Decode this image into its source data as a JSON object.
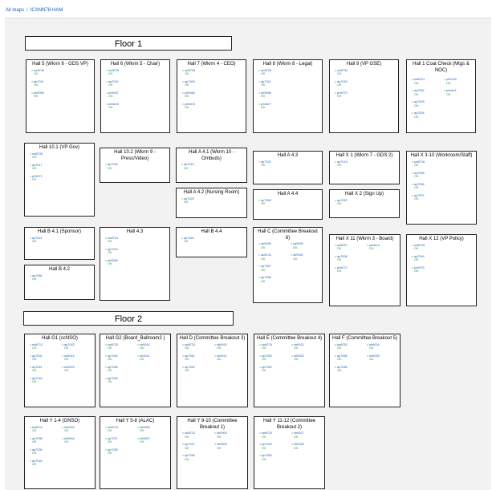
{
  "breadcrumb": {
    "all_maps": "All maps",
    "separator": "/",
    "current": "ICANN78-HAM"
  },
  "floors": {
    "floor1": "Floor 1",
    "floor2": "Floor 2"
  },
  "status_color": "#2e9a2e",
  "link_color": "#1a5fb4",
  "halls": [
    {
      "id": "hall-5",
      "title": "Hall 5 (Wkrm 6 - GDS VP)",
      "devices": [
        {
          "name": "sw8740",
          "status": "OK"
        },
        {
          "name": "ap7011",
          "status": "OK"
        },
        {
          "name": "ph9069",
          "status": "OK"
        }
      ]
    },
    {
      "id": "hall-6",
      "title": "Hall 6 (Wkrm 5 - Chair)",
      "devices": [
        {
          "name": "sw8729",
          "status": "OK"
        },
        {
          "name": "ap7010",
          "status": "OK"
        },
        {
          "name": "ph9067",
          "status": "OK"
        },
        {
          "name": "printer6",
          "status": "OK"
        }
      ]
    },
    {
      "id": "hall-7",
      "title": "Hall 7 (Wkrm 4 - CEO)",
      "devices": [
        {
          "name": "sw8728",
          "status": "OK"
        },
        {
          "name": "ap7009",
          "status": "OK"
        },
        {
          "name": "ph9066",
          "status": "OK"
        },
        {
          "name": "printer5",
          "status": "OK"
        }
      ]
    },
    {
      "id": "hall-8",
      "title": "Hall 8 (Wkrm 8 - Legal)",
      "devices": [
        {
          "name": "sw8725",
          "status": "OK"
        },
        {
          "name": "ap7012",
          "status": "OK"
        },
        {
          "name": "ph9068",
          "status": "OK"
        },
        {
          "name": "printer7",
          "status": "OK"
        }
      ]
    },
    {
      "id": "hall-9",
      "title": "Hall 9 (VP GSE)",
      "devices": [
        {
          "name": "sw8732",
          "status": "OK"
        },
        {
          "name": "ap7015",
          "status": "OK"
        },
        {
          "name": "ph9073",
          "status": "OK"
        }
      ]
    },
    {
      "id": "hall-1",
      "title": "Hall 1 Coat Check (Mtgs & NOC)",
      "devices": [
        {
          "name": "sw8701",
          "status": "OK"
        },
        {
          "name": "ph0218",
          "status": "OK"
        },
        {
          "name": "ap7002",
          "status": "OK"
        },
        {
          "name": "printer1",
          "status": "OK"
        },
        {
          "name": "ap7003",
          "status": "OK"
        },
        {
          "name": "ap7004",
          "status": "OK"
        }
      ]
    },
    {
      "id": "hall-10-1",
      "title": "Hall 10.1 (VP Gov)",
      "devices": [
        {
          "name": "sw8735",
          "status": "OK"
        },
        {
          "name": "ap7017",
          "status": "OK"
        },
        {
          "name": "ph9071",
          "status": "OK"
        }
      ]
    },
    {
      "id": "hall-10-2",
      "title": "Hall 10.2 (Wkrm 9 - Press/Video)",
      "devices": [
        {
          "name": "ap7018",
          "status": "OK"
        }
      ]
    },
    {
      "id": "hall-a-4-1",
      "title": "Hall A 4.1 (Wkrm 10 - Ombuds)",
      "devices": [
        {
          "name": "ap7014",
          "status": "OK"
        }
      ]
    },
    {
      "id": "hall-a-4-3",
      "title": "Hall A 4.3",
      "devices": [
        {
          "name": "ap7022",
          "status": "OK"
        }
      ]
    },
    {
      "id": "hall-x-1",
      "title": "Hall X 1 (Wkrm 7 - GDS 2)",
      "devices": [
        {
          "name": "ap7013",
          "status": "OK"
        }
      ]
    },
    {
      "id": "hall-x-3-10",
      "title": "Hall X 3-10 (Workroom/Staff)",
      "devices": [
        {
          "name": "sw8726",
          "status": "OK"
        },
        {
          "name": "ap7005",
          "status": "OK"
        },
        {
          "name": "ap7006",
          "status": "OK"
        },
        {
          "name": "ap7007",
          "status": "OK"
        }
      ]
    },
    {
      "id": "hall-a-4-2",
      "title": "Hall A 4.2 (Nursing Room)",
      "devices": [
        {
          "name": "ap7023",
          "status": "OK"
        }
      ]
    },
    {
      "id": "hall-a-4-4",
      "title": "Hall A 4.4",
      "devices": [
        {
          "name": "ap7059",
          "status": "OK"
        }
      ]
    },
    {
      "id": "hall-x-2",
      "title": "Hall X 2 (Sign Up)",
      "devices": [
        {
          "name": "ap7020",
          "status": "OK"
        }
      ]
    },
    {
      "id": "hall-b-4-1",
      "title": "Hall B 4.1 (Sponsor)",
      "devices": [
        {
          "name": "ap7021",
          "status": "OK"
        }
      ]
    },
    {
      "id": "hall-4-3",
      "title": "Hall 4.3",
      "devices": [
        {
          "name": "sw8731",
          "status": "OK"
        },
        {
          "name": "ap7019",
          "status": "OK"
        },
        {
          "name": "ph9065",
          "status": "OK"
        }
      ]
    },
    {
      "id": "hall-b-4-4",
      "title": "Hall B 4.4",
      "devices": [
        {
          "name": "ap7061",
          "status": "OK"
        }
      ]
    },
    {
      "id": "hall-c",
      "title": "Hall C (Committee Breakout 6)",
      "devices": [
        {
          "name": "str9039",
          "status": "OK"
        },
        {
          "name": "str9039",
          "status": "OK"
        },
        {
          "name": "sw8741",
          "status": "OK"
        },
        {
          "name": "str9040",
          "status": "OK"
        },
        {
          "name": "ap7057",
          "status": "OK"
        },
        {
          "name": "ap7058",
          "status": "OK"
        }
      ]
    },
    {
      "id": "hall-x-11",
      "title": "Hall X 11 (Wkrm 3 - Board)",
      "devices": [
        {
          "name": "sw8727",
          "status": "OK"
        },
        {
          "name": "printer3",
          "status": "OK"
        },
        {
          "name": "ap7008",
          "status": "OK"
        },
        {
          "name": "ph9072",
          "status": "OK"
        }
      ]
    },
    {
      "id": "hall-x-12",
      "title": "Hall X 12 (VP Policy)",
      "devices": [
        {
          "name": "sw8733",
          "status": "OK"
        },
        {
          "name": "ap7016",
          "status": "OK"
        },
        {
          "name": "ph9075",
          "status": "OK"
        }
      ]
    },
    {
      "id": "hall-b-4-2",
      "title": "Hall B 4.2",
      "devices": [
        {
          "name": "ap7060",
          "status": "OK"
        }
      ]
    },
    {
      "id": "hall-g1",
      "title": "Hall G1 (ccNSO)",
      "devices": [
        {
          "name": "sw8713",
          "status": "OK"
        },
        {
          "name": "ap7043",
          "status": "OK"
        },
        {
          "name": "ap7031",
          "status": "OK"
        },
        {
          "name": "str9014",
          "status": "OK"
        },
        {
          "name": "ap7041",
          "status": "OK"
        },
        {
          "name": "str9015",
          "status": "OK"
        },
        {
          "name": "ap7042",
          "status": "OK"
        }
      ]
    },
    {
      "id": "hall-g2",
      "title": "Hall G2 (Board_Ballroom2 )",
      "devices": [
        {
          "name": "sw8720",
          "status": "OK"
        },
        {
          "name": "str9010",
          "status": "OK"
        },
        {
          "name": "ap7044",
          "status": "OK"
        },
        {
          "name": "str9011",
          "status": "OK"
        },
        {
          "name": "ap7045",
          "status": "OK"
        },
        {
          "name": "ap7046",
          "status": "OK"
        }
      ]
    },
    {
      "id": "hall-d",
      "title": "Hall D (Committee Breakout 3)",
      "devices": [
        {
          "name": "sw8723",
          "status": "OK"
        },
        {
          "name": "str9020",
          "status": "OK"
        },
        {
          "name": "ap7051",
          "status": "OK"
        },
        {
          "name": "str9021",
          "status": "OK"
        },
        {
          "name": "ap7052",
          "status": "OK"
        }
      ]
    },
    {
      "id": "hall-e",
      "title": "Hall E (Committee Breakout 4)",
      "devices": [
        {
          "name": "sw8724",
          "status": "OK"
        },
        {
          "name": "str9022",
          "status": "OK"
        },
        {
          "name": "ap7053",
          "status": "OK"
        },
        {
          "name": "str9023",
          "status": "OK"
        },
        {
          "name": "ap7054",
          "status": "OK"
        }
      ]
    },
    {
      "id": "hall-f",
      "title": "Hall F (Committee Breakout 5)",
      "devices": [
        {
          "name": "sw8752",
          "status": "OK"
        },
        {
          "name": "str9024",
          "status": "OK"
        },
        {
          "name": "ap7055",
          "status": "OK"
        },
        {
          "name": "str9025",
          "status": "OK"
        },
        {
          "name": "ap7056",
          "status": "OK"
        }
      ]
    },
    {
      "id": "hall-y-1-4",
      "title": "Hall Y 1-4 (GNSO)",
      "devices": [
        {
          "name": "sw8712",
          "status": "OK"
        },
        {
          "name": "str9043",
          "status": "OK"
        },
        {
          "name": "ap7038",
          "status": "OK"
        },
        {
          "name": "str9044",
          "status": "OK"
        },
        {
          "name": "ap7039",
          "status": "OK"
        },
        {
          "name": "ap7040",
          "status": "OK"
        }
      ]
    },
    {
      "id": "hall-y-5-8",
      "title": "Hall Y 5-8 (ALAC)",
      "devices": [
        {
          "name": "sw8710",
          "status": "OK"
        },
        {
          "name": "str9006",
          "status": "OK"
        },
        {
          "name": "ap7027",
          "status": "OK"
        },
        {
          "name": "str9007",
          "status": "OK"
        },
        {
          "name": "ap7028",
          "status": "OK"
        }
      ]
    },
    {
      "id": "hall-y-9-10",
      "title": "Hall Y 9-10 (Committee Breakout 1)",
      "devices": [
        {
          "name": "sw8721",
          "status": "OK"
        },
        {
          "name": "str9004",
          "status": "OK"
        },
        {
          "name": "ap7047",
          "status": "OK"
        },
        {
          "name": "str9005",
          "status": "OK"
        },
        {
          "name": "ap7048",
          "status": "OK"
        }
      ]
    },
    {
      "id": "hall-y-11-12",
      "title": "Hall Y 11-12 (Committee Breakout 2)",
      "devices": [
        {
          "name": "sw8722",
          "status": "OK"
        },
        {
          "name": "str9027",
          "status": "OK"
        },
        {
          "name": "ap7049",
          "status": "OK"
        },
        {
          "name": "str9028",
          "status": "OK"
        },
        {
          "name": "ap7050",
          "status": "OK"
        }
      ]
    }
  ]
}
